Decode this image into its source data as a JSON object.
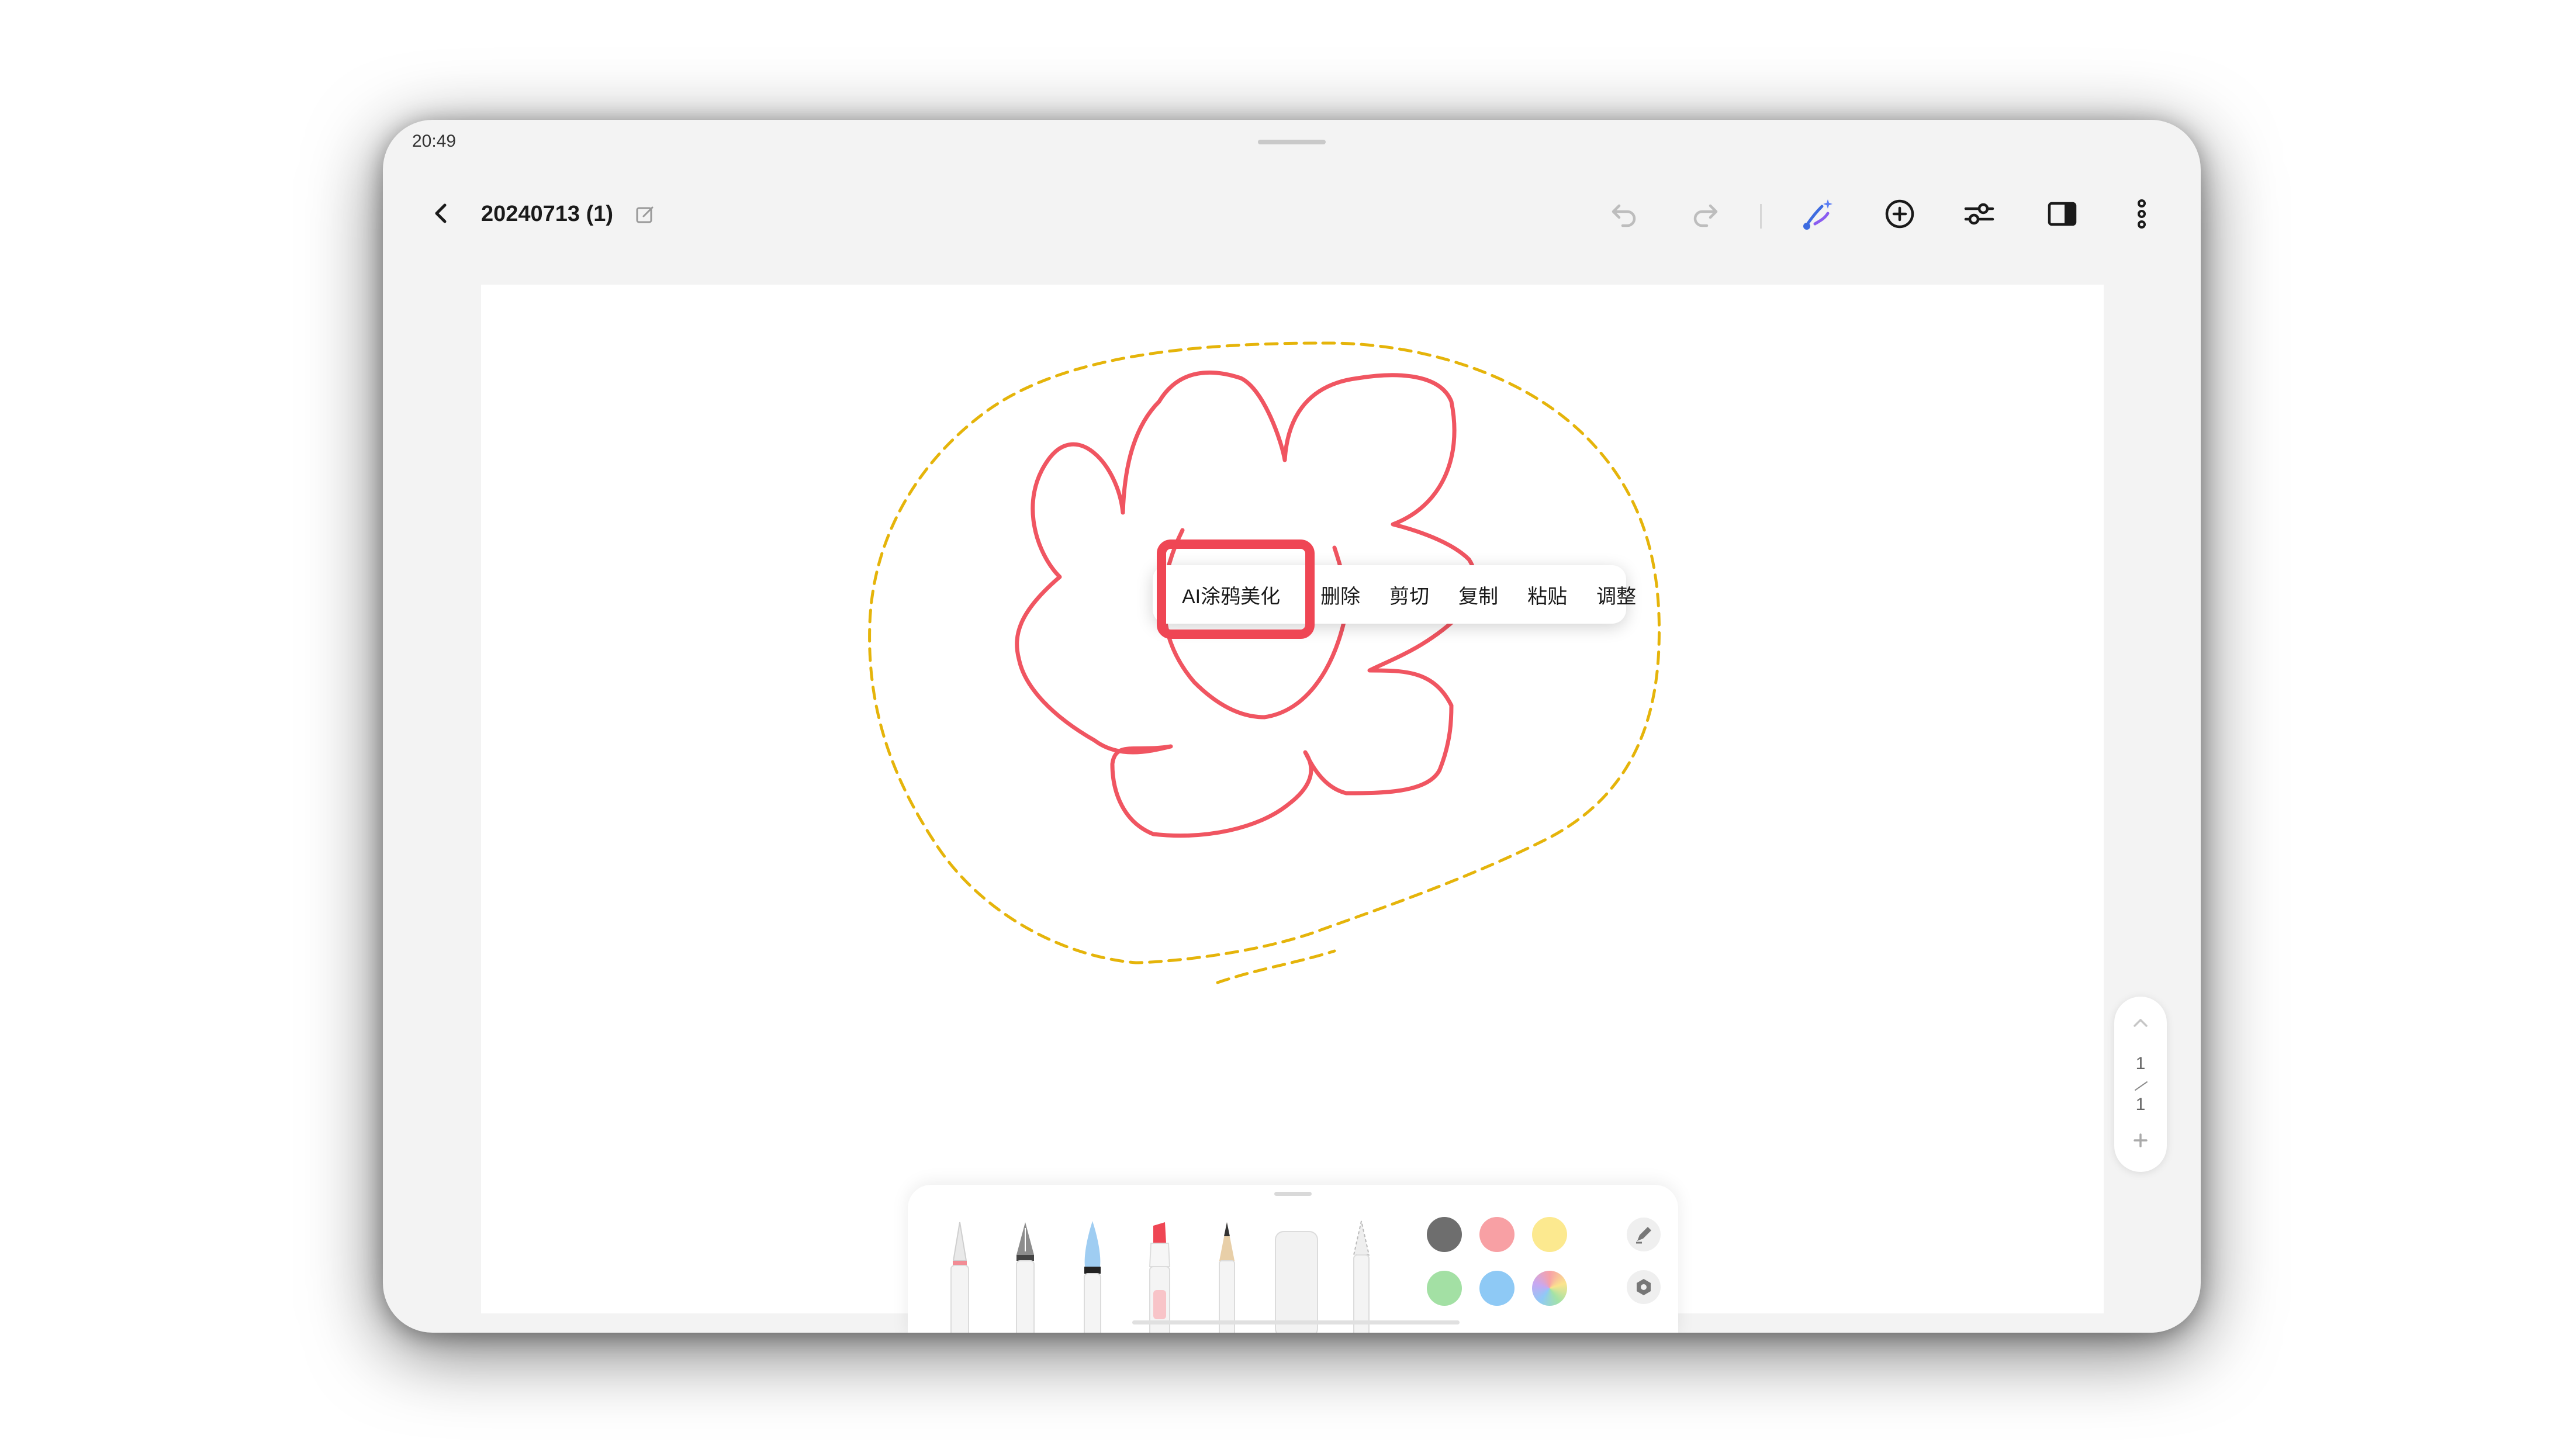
{
  "status_bar": {
    "time": "20:49"
  },
  "header": {
    "title": "20240713 (1)",
    "icons": [
      "back-icon",
      "edit-icon",
      "undo-icon",
      "redo-icon",
      "ai-doodle-icon",
      "add-icon",
      "adjust-icon",
      "side-panel-icon",
      "more-icon"
    ]
  },
  "context_menu": {
    "items": [
      "AI涂鸦美化",
      "删除",
      "剪切",
      "复制",
      "粘贴",
      "调整"
    ],
    "highlighted_item": "AI涂鸦美化"
  },
  "page_nav": {
    "current": "1",
    "total": "1"
  },
  "drawing": {
    "stroke_color": "#f05561",
    "selection_color": "#e5b40a"
  },
  "pen_toolbar": {
    "tools": [
      "ballpoint-pen",
      "fountain-pen",
      "brush-pen",
      "highlighter",
      "pencil",
      "eraser",
      "lasso"
    ],
    "colors": [
      "#6e6e6e",
      "#f8a0a4",
      "#fce98f",
      "#a3e0a4",
      "#8ec9f5",
      "rainbow"
    ]
  },
  "accent": "#ef4654"
}
